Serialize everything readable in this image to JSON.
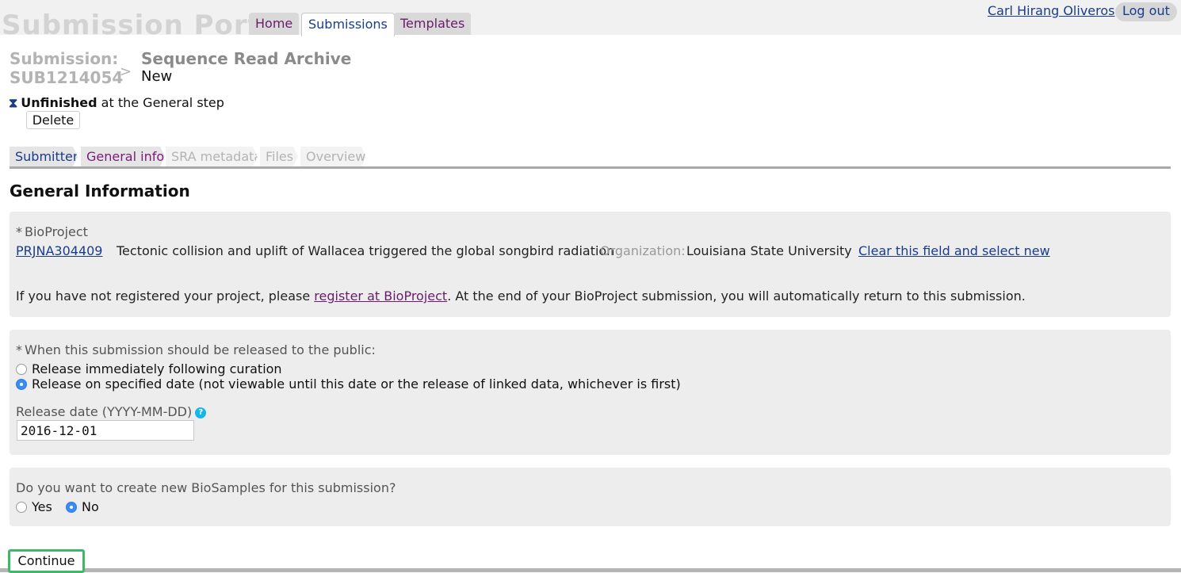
{
  "app": {
    "title": "Submission Portal",
    "nav_tabs": [
      {
        "label": "Home",
        "active": false
      },
      {
        "label": "Submissions",
        "active": true
      },
      {
        "label": "Templates",
        "active": false
      }
    ],
    "user_name": "Carl Hirang Oliveros",
    "logout_label": "Log out"
  },
  "submission": {
    "label": "Submission:",
    "id": "SUB1214054",
    "separator": ">",
    "type": "Sequence Read Archive",
    "state": "New",
    "status_icon": "hourglass-icon",
    "status_bold": "Unfinished",
    "status_rest": "at the General step",
    "delete_label": "Delete"
  },
  "steps": [
    {
      "label": "Submitter",
      "state": "done"
    },
    {
      "label": "General info",
      "state": "current"
    },
    {
      "label": "SRA metadata",
      "state": "todo"
    },
    {
      "label": "Files",
      "state": "todo"
    },
    {
      "label": "Overview",
      "state": "todo"
    }
  ],
  "section_title": "General Information",
  "bioproject": {
    "required_mark": "*",
    "label": "BioProject",
    "accession": "PRJNA304409",
    "title": "Tectonic collision and uplift of Wallacea triggered the global songbird radiation",
    "org_label": "Organization:",
    "org_value": "Louisiana State University",
    "clear_link": "Clear this field and select new",
    "note_before": "If you have not registered your project, please",
    "note_link": "register at BioProject",
    "note_after": ". At the end of your BioProject submission, you will automatically return to this submission."
  },
  "release": {
    "required_mark": "*",
    "question": "When this submission should be released to the public:",
    "options": [
      {
        "label": "Release immediately following curation",
        "selected": false
      },
      {
        "label": "Release on specified date (not viewable until this date or the release of linked data, whichever is first)",
        "selected": true
      }
    ],
    "date_label": "Release date (YYYY-MM-DD)",
    "help_icon": "question-icon",
    "help_glyph": "?",
    "date_value": "2016-12-01"
  },
  "biosamples": {
    "question": "Do you want to create new BioSamples for this submission?",
    "options": [
      {
        "label": "Yes",
        "selected": false
      },
      {
        "label": "No",
        "selected": true
      }
    ]
  },
  "continue_label": "Continue",
  "colors": {
    "link": "#1a3c8c",
    "visited_link": "#6a1b6b",
    "radio_selected": "#3b8cf0",
    "continue_border": "#3fb86a",
    "help_icon": "#16b6e8"
  }
}
